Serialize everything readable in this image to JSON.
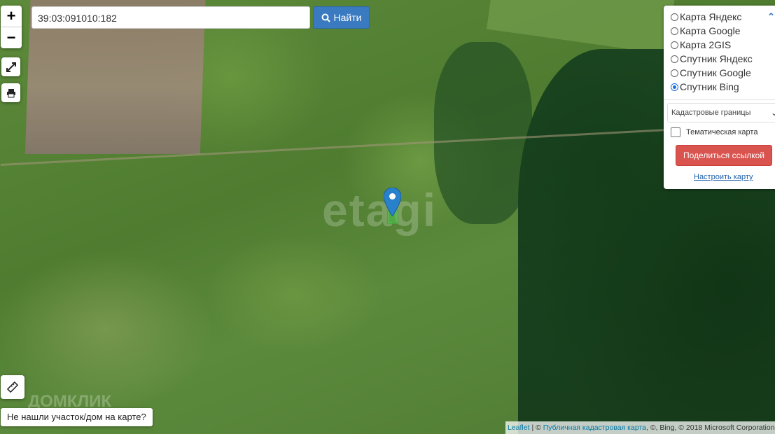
{
  "search": {
    "value": "39:03:091010:182",
    "button_label": "Найти"
  },
  "zoom": {
    "in_label": "+",
    "out_label": "−"
  },
  "layers": {
    "options": [
      {
        "label": "Карта Яндекс",
        "checked": false
      },
      {
        "label": "Карта Google",
        "checked": false
      },
      {
        "label": "Карта 2GIS",
        "checked": false
      },
      {
        "label": "Спутник Яндекс",
        "checked": false
      },
      {
        "label": "Спутник Google",
        "checked": false
      },
      {
        "label": "Спутник Bing",
        "checked": true
      }
    ],
    "overlay_select": "Кадастровые границы",
    "thematic_label": "Тематическая карта",
    "share_label": "Поделиться ссылкой",
    "configure_label": "Настроить карту"
  },
  "map": {
    "watermark": "etagi",
    "watermark2": "ДОМКЛИК",
    "accent_color": "#3a7ac0",
    "marker_color": "#2a81cb"
  },
  "footer": {
    "not_found_label": "Не нашли участок/дом на карте?",
    "attribution": {
      "leaflet": "Leaflet",
      "sep1": " | © ",
      "cadastral": "Публичная кадастровая карта",
      "rest": ", ©, Bing, © 2018 Microsoft Corporation"
    }
  }
}
